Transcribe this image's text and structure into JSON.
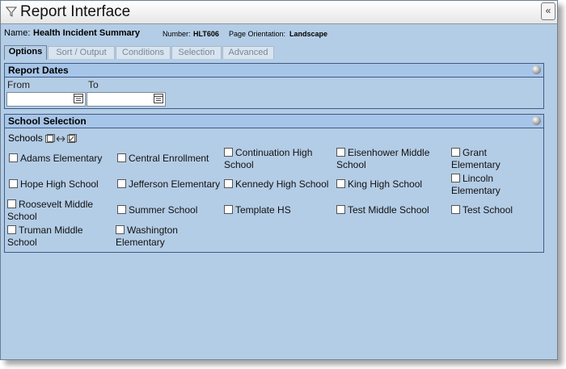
{
  "window": {
    "title": "Report Interface",
    "collapse_glyph": "«"
  },
  "info": {
    "name_label": "Name:",
    "name_value": "Health Incident Summary",
    "number_label": "Number:",
    "number_value": "HLT606",
    "orientation_label": "Page Orientation:",
    "orientation_value": "Landscape"
  },
  "tabs": [
    {
      "label": "Options",
      "active": true
    },
    {
      "label": "Sort / Output",
      "active": false
    },
    {
      "label": "Conditions",
      "active": false
    },
    {
      "label": "Selection",
      "active": false
    },
    {
      "label": "Advanced",
      "active": false
    }
  ],
  "report_dates": {
    "heading": "Report Dates",
    "from_label": "From",
    "from_value": "",
    "to_label": "To",
    "to_value": ""
  },
  "school_selection": {
    "heading": "School Selection",
    "schools_label": "Schools",
    "schools": [
      {
        "name": "Adams Elementary",
        "checked": false
      },
      {
        "name": "Central Enrollment",
        "checked": false
      },
      {
        "name": "Continuation High School",
        "checked": false
      },
      {
        "name": "Eisenhower Middle School",
        "checked": false
      },
      {
        "name": "Grant Elementary",
        "checked": false
      },
      {
        "name": "Hope High School",
        "checked": false
      },
      {
        "name": "Jefferson Elementary",
        "checked": false
      },
      {
        "name": "Kennedy High School",
        "checked": false
      },
      {
        "name": "King High School",
        "checked": false
      },
      {
        "name": "Lincoln Elementary",
        "checked": false
      },
      {
        "name": "Roosevelt Middle School",
        "checked": false
      },
      {
        "name": "Summer School",
        "checked": false
      },
      {
        "name": "Template HS",
        "checked": false
      },
      {
        "name": "Test Middle School",
        "checked": false
      },
      {
        "name": "Test School",
        "checked": false
      },
      {
        "name": "Truman Middle School",
        "checked": false
      },
      {
        "name": "Washington Elementary",
        "checked": false
      }
    ]
  },
  "colors": {
    "window_bg": "#b4cde6",
    "panel_header": "#a7c5e8",
    "border": "#3d5b86"
  }
}
